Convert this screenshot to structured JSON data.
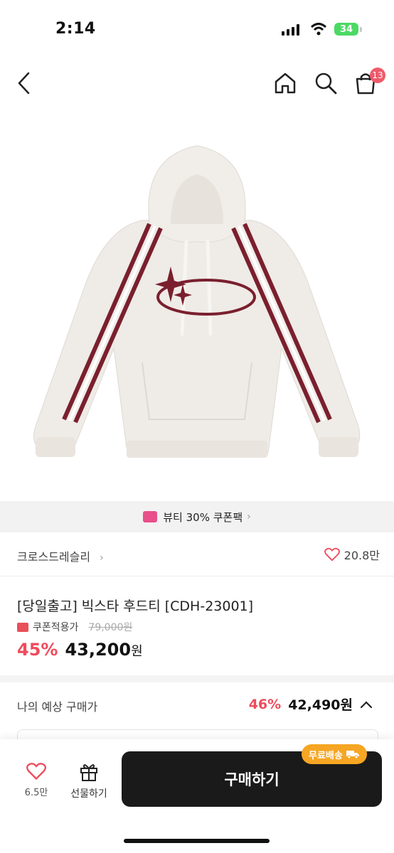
{
  "status_bar": {
    "time": "2:14",
    "battery": "34"
  },
  "nav": {
    "back": "back-icon",
    "home": "home-icon",
    "search": "search-icon",
    "bag": "bag-icon",
    "bag_count": "13"
  },
  "coupon_banner": {
    "label": "뷰티 30% 쿠폰팩",
    "chevron": "›"
  },
  "brand": {
    "name": "크로스드레슬리",
    "chevron": "›",
    "likes": "20.8만"
  },
  "product": {
    "title": "[당일출고] 빅스타 후드티 [CDH-23001]",
    "coupon_label": "쿠폰적용가",
    "original_price": "79,000원",
    "discount_rate": "45%",
    "price": "43,200",
    "price_unit": "원"
  },
  "expected": {
    "label": "나의 예상 구매가",
    "rate": "46%",
    "price": "42,490원"
  },
  "bottom_bar": {
    "like_count": "6.5만",
    "gift_label": "선물하기",
    "buy_label": "구매하기",
    "shipping_badge": "무료배송"
  },
  "colors": {
    "accent": "#ef4b5c",
    "buy_button": "#1a1a1a",
    "shipping": "#f6a623",
    "stripe": "#7a1f2e",
    "hoodie": "#efebe6"
  }
}
